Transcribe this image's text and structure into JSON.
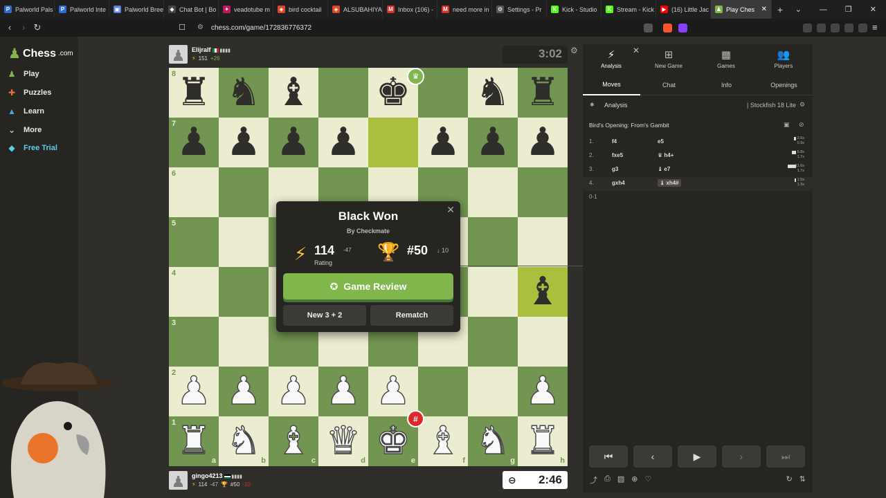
{
  "browser": {
    "tabs": [
      {
        "label": "Palworld Pals",
        "icon": "P",
        "color": "#2e6bd8"
      },
      {
        "label": "Palworld Inte",
        "icon": "P",
        "color": "#2e6bd8"
      },
      {
        "label": "Palworld Bree",
        "icon": "▣",
        "color": "#5a7fe0"
      },
      {
        "label": "Chat Bot | Bo",
        "icon": "◆",
        "color": "#444"
      },
      {
        "label": "veadotube m",
        "icon": "✦",
        "color": "#c2185b"
      },
      {
        "label": "bird cocktail",
        "icon": "◈",
        "color": "#e0452a"
      },
      {
        "label": "ALSUBAHIYA",
        "icon": "◈",
        "color": "#e0452a"
      },
      {
        "label": "Inbox (106) -",
        "icon": "M",
        "color": "#d93025"
      },
      {
        "label": "need more in",
        "icon": "M",
        "color": "#d93025"
      },
      {
        "label": "Settings - Pr",
        "icon": "⚙",
        "color": "#555"
      },
      {
        "label": "Kick - Studio",
        "icon": "K",
        "color": "#53fc18"
      },
      {
        "label": "Stream - Kick",
        "icon": "K",
        "color": "#53fc18"
      },
      {
        "label": "(16) Little Jac",
        "icon": "▶",
        "color": "#ff0000"
      },
      {
        "label": "Play Ches",
        "icon": "♟",
        "color": "#81b64c"
      }
    ],
    "url": "chess.com/game/172836776372"
  },
  "sidebar": {
    "logo_text": "Chess",
    "logo_domain": ".com",
    "items": [
      {
        "label": "Play",
        "icon": "♟",
        "color": "#81b64c"
      },
      {
        "label": "Puzzles",
        "icon": "✚",
        "color": "#e8713a"
      },
      {
        "label": "Learn",
        "icon": "▲",
        "color": "#4aa3df"
      },
      {
        "label": "More",
        "icon": "⌄",
        "color": "#ccc"
      },
      {
        "label": "Free Trial",
        "icon": "◆",
        "color": "#5ad1e8"
      }
    ]
  },
  "top_player": {
    "name": "Elijralf",
    "rating": "151",
    "delta": "+26",
    "clock": "3:02"
  },
  "bottom_player": {
    "name": "gingo4213",
    "rating": "114",
    "delta": "-47",
    "rank": "#50",
    "rank_delta": "-10",
    "clock": "2:46"
  },
  "board": {
    "ranks": [
      "8",
      "7",
      "6",
      "5",
      "4",
      "3",
      "2",
      "1"
    ],
    "files": [
      "a",
      "b",
      "c",
      "d",
      "e",
      "f",
      "g",
      "h"
    ],
    "position": [
      [
        "br",
        "bn",
        "bb",
        "",
        "bk",
        "",
        "bn",
        "br"
      ],
      [
        "bp",
        "bp",
        "bp",
        "bp",
        "",
        "bp",
        "bp",
        "bp"
      ],
      [
        "",
        "",
        "",
        "",
        "",
        "",
        "",
        ""
      ],
      [
        "",
        "",
        "",
        "",
        "",
        "",
        "",
        ""
      ],
      [
        "",
        "",
        "",
        "",
        "",
        "",
        "",
        "bb"
      ],
      [
        "",
        "",
        "",
        "",
        "",
        "",
        "",
        ""
      ],
      [
        "wp",
        "wp",
        "wp",
        "wp",
        "wp",
        "",
        "",
        "wp"
      ],
      [
        "wr",
        "wn",
        "wb",
        "wq",
        "wk",
        "wb",
        "wn",
        "wr"
      ]
    ],
    "highlights": [
      "e7",
      "h4"
    ]
  },
  "modal": {
    "title": "Black Won",
    "subtitle": "By Checkmate",
    "rating": "114",
    "rating_delta": "-47",
    "rating_label": "Rating",
    "rank": "#50",
    "rank_delta": "↓ 10",
    "review_label": "Game Review",
    "new_label": "New 3 + 2",
    "rematch_label": "Rematch"
  },
  "panel": {
    "top_tabs": [
      {
        "label": "Analysis",
        "icon": "⚡"
      },
      {
        "label": "New Game",
        "icon": "⊞"
      },
      {
        "label": "Games",
        "icon": "▦"
      },
      {
        "label": "Players",
        "icon": "👥"
      }
    ],
    "sub_tabs": [
      "Moves",
      "Chat",
      "Info",
      "Openings"
    ],
    "analysis_label": "Analysis",
    "engine": "Stockfish 18 Lite",
    "opening": "Bird's Opening: From's Gambit",
    "moves": [
      {
        "num": "1.",
        "white": "f4",
        "black": "e5",
        "tw": "2.6s",
        "tb": "0.9s"
      },
      {
        "num": "2.",
        "white": "fxe5",
        "black": "♛ h4+",
        "tw": "5.8s",
        "tb": "1.7s"
      },
      {
        "num": "3.",
        "white": "g3",
        "black": "♝ e7",
        "tw": "11.6s",
        "tb": "1.7s"
      },
      {
        "num": "4.",
        "white": "gxh4",
        "black": "♝ xh4#",
        "tw": "1.5s",
        "tb": "1.3s"
      }
    ],
    "result": "0-1"
  }
}
